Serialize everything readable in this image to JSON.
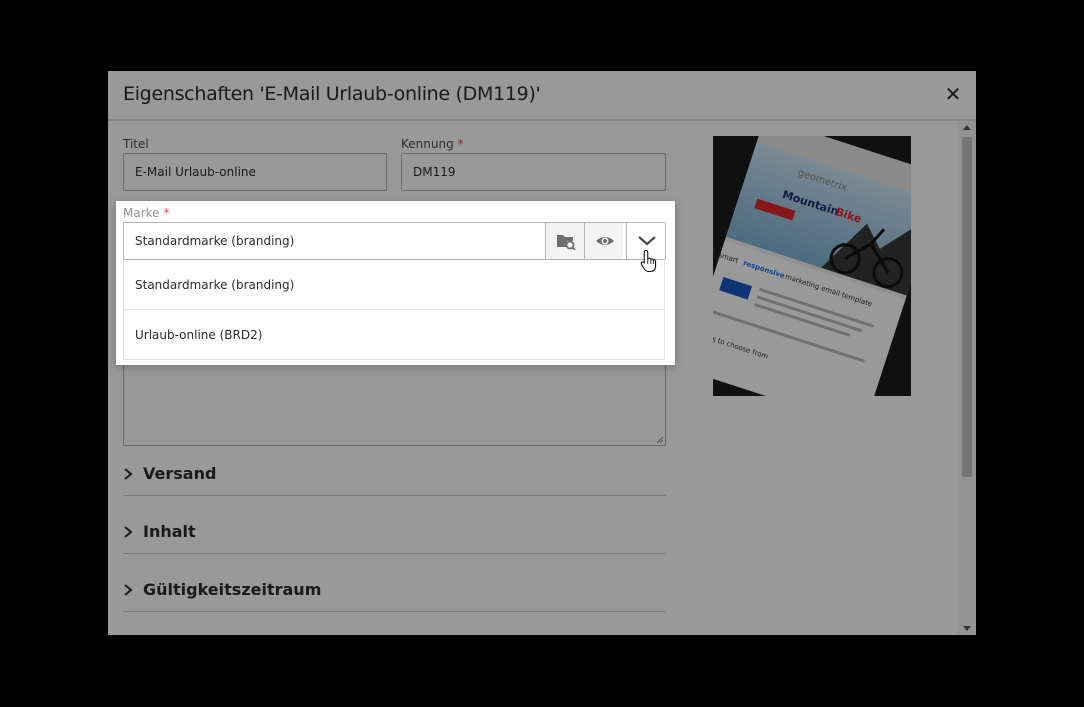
{
  "dialog": {
    "title": "Eigenschaften 'E-Mail Urlaub-online (DM119)'",
    "close_icon": "close-icon"
  },
  "form": {
    "title_label": "Titel",
    "title_value": "E-Mail Urlaub-online",
    "id_label": "Kennung",
    "id_value": "DM119",
    "required_marker": "*",
    "brand_label": "Marke",
    "brand_value": "Standardmarke (branding)"
  },
  "brand_dropdown": {
    "options": [
      "Standardmarke (branding)",
      "Urlaub-online (BRD2)"
    ],
    "icons": [
      "browse-icon",
      "preview-eye-icon",
      "chevron-down-icon"
    ]
  },
  "sections": [
    {
      "label": "Versand"
    },
    {
      "label": "Inhalt"
    },
    {
      "label": "Gültigkeitszeitraum"
    }
  ],
  "thumbnail": {
    "logo": "geometrix",
    "headline_1": "Mountain",
    "headline_2": "Bike",
    "body_1": "smart",
    "body_2": "responsive",
    "body_3": "marketing email template",
    "body_4": "layouts to choose from"
  },
  "colors": {
    "required": "#e34850",
    "bike_red": "#e0262c",
    "link_blue": "#1a73e8"
  }
}
